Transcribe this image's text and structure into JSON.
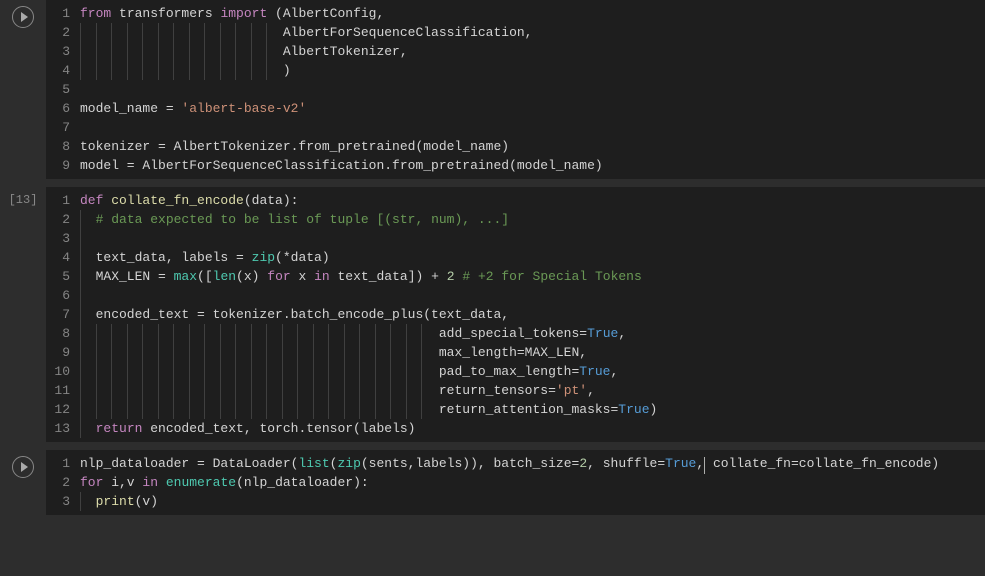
{
  "cells": [
    {
      "indicator": "play",
      "exec_label": "",
      "lines": [
        {
          "n": "1",
          "t": [
            [
              "kw",
              "from"
            ],
            [
              "op",
              " transformers "
            ],
            [
              "kw",
              "import"
            ],
            [
              "op",
              " (AlbertConfig,"
            ]
          ]
        },
        {
          "n": "2",
          "g": [
            0,
            1,
            2,
            3,
            4,
            5,
            6,
            7,
            8,
            9,
            10,
            11,
            12
          ],
          "t": [
            [
              "op",
              "                          AlbertForSequenceClassification,"
            ]
          ]
        },
        {
          "n": "3",
          "g": [
            0,
            1,
            2,
            3,
            4,
            5,
            6,
            7,
            8,
            9,
            10,
            11,
            12
          ],
          "t": [
            [
              "op",
              "                          AlbertTokenizer,"
            ]
          ]
        },
        {
          "n": "4",
          "g": [
            0,
            1,
            2,
            3,
            4,
            5,
            6,
            7,
            8,
            9,
            10,
            11,
            12
          ],
          "t": [
            [
              "op",
              "                          )"
            ]
          ]
        },
        {
          "n": "5",
          "t": []
        },
        {
          "n": "6",
          "t": [
            [
              "op",
              "model_name = "
            ],
            [
              "str",
              "'albert-base-v2'"
            ]
          ]
        },
        {
          "n": "7",
          "t": []
        },
        {
          "n": "8",
          "t": [
            [
              "op",
              "tokenizer = AlbertTokenizer.from_pretrained(model_name)"
            ]
          ]
        },
        {
          "n": "9",
          "t": [
            [
              "op",
              "model = AlbertForSequenceClassification.from_pretrained(model_name)"
            ]
          ]
        }
      ]
    },
    {
      "indicator": "label",
      "exec_label": "[13]",
      "lines": [
        {
          "n": "1",
          "t": [
            [
              "kw",
              "def"
            ],
            [
              "op",
              " "
            ],
            [
              "fn",
              "collate_fn_encode"
            ],
            [
              "op",
              "(data):"
            ]
          ]
        },
        {
          "n": "2",
          "g": [
            0
          ],
          "t": [
            [
              "op",
              "  "
            ],
            [
              "cmt",
              "# data expected to be list of tuple [(str, num), ...]"
            ]
          ]
        },
        {
          "n": "3",
          "g": [
            0
          ],
          "t": []
        },
        {
          "n": "4",
          "g": [
            0
          ],
          "t": [
            [
              "op",
              "  text_data, labels = "
            ],
            [
              "cls",
              "zip"
            ],
            [
              "op",
              "(*data)"
            ]
          ]
        },
        {
          "n": "5",
          "g": [
            0
          ],
          "t": [
            [
              "op",
              "  MAX_LEN = "
            ],
            [
              "cls",
              "max"
            ],
            [
              "op",
              "(["
            ],
            [
              "cls",
              "len"
            ],
            [
              "op",
              "(x) "
            ],
            [
              "kw",
              "for"
            ],
            [
              "op",
              " x "
            ],
            [
              "kw",
              "in"
            ],
            [
              "op",
              " text_data]) + "
            ],
            [
              "num",
              "2"
            ],
            [
              "op",
              " "
            ],
            [
              "cmt",
              "# +2 for Special Tokens"
            ]
          ]
        },
        {
          "n": "6",
          "g": [
            0
          ],
          "t": []
        },
        {
          "n": "7",
          "g": [
            0
          ],
          "t": [
            [
              "op",
              "  encoded_text = tokenizer.batch_encode_plus(text_data,"
            ]
          ]
        },
        {
          "n": "8",
          "g": [
            0,
            1,
            2,
            3,
            4,
            5,
            6,
            7,
            8,
            9,
            10,
            11,
            12,
            13,
            14,
            15,
            16,
            17,
            18,
            19,
            20,
            21,
            22
          ],
          "t": [
            [
              "op",
              "                                              add_special_tokens="
            ],
            [
              "bool",
              "True"
            ],
            [
              "op",
              ","
            ]
          ]
        },
        {
          "n": "9",
          "g": [
            0,
            1,
            2,
            3,
            4,
            5,
            6,
            7,
            8,
            9,
            10,
            11,
            12,
            13,
            14,
            15,
            16,
            17,
            18,
            19,
            20,
            21,
            22
          ],
          "t": [
            [
              "op",
              "                                              max_length=MAX_LEN,"
            ]
          ]
        },
        {
          "n": "10",
          "g": [
            0,
            1,
            2,
            3,
            4,
            5,
            6,
            7,
            8,
            9,
            10,
            11,
            12,
            13,
            14,
            15,
            16,
            17,
            18,
            19,
            20,
            21,
            22
          ],
          "t": [
            [
              "op",
              "                                              pad_to_max_length="
            ],
            [
              "bool",
              "True"
            ],
            [
              "op",
              ","
            ]
          ]
        },
        {
          "n": "11",
          "g": [
            0,
            1,
            2,
            3,
            4,
            5,
            6,
            7,
            8,
            9,
            10,
            11,
            12,
            13,
            14,
            15,
            16,
            17,
            18,
            19,
            20,
            21,
            22
          ],
          "t": [
            [
              "op",
              "                                              return_tensors="
            ],
            [
              "str",
              "'pt'"
            ],
            [
              "op",
              ","
            ]
          ]
        },
        {
          "n": "12",
          "g": [
            0,
            1,
            2,
            3,
            4,
            5,
            6,
            7,
            8,
            9,
            10,
            11,
            12,
            13,
            14,
            15,
            16,
            17,
            18,
            19,
            20,
            21,
            22
          ],
          "t": [
            [
              "op",
              "                                              return_attention_masks="
            ],
            [
              "bool",
              "True"
            ],
            [
              "op",
              ")"
            ]
          ]
        },
        {
          "n": "13",
          "g": [
            0
          ],
          "t": [
            [
              "op",
              "  "
            ],
            [
              "kw",
              "return"
            ],
            [
              "op",
              " encoded_text, torch.tensor(labels)"
            ]
          ]
        }
      ]
    },
    {
      "indicator": "play",
      "exec_label": "",
      "lines": [
        {
          "n": "1",
          "t": [
            [
              "op",
              "nlp_dataloader = DataLoader("
            ],
            [
              "cls",
              "list"
            ],
            [
              "op",
              "("
            ],
            [
              "cls",
              "zip"
            ],
            [
              "op",
              "(sents,labels)), batch_size="
            ],
            [
              "num",
              "2"
            ],
            [
              "op",
              ", shuffle="
            ],
            [
              "bool",
              "True"
            ],
            [
              "op",
              ","
            ],
            [
              "cursor",
              ""
            ],
            [
              "op",
              " collate_fn=collate_fn_encode)"
            ]
          ]
        },
        {
          "n": "2",
          "t": [
            [
              "kw",
              "for"
            ],
            [
              "op",
              " i,v "
            ],
            [
              "kw",
              "in"
            ],
            [
              "op",
              " "
            ],
            [
              "cls",
              "enumerate"
            ],
            [
              "op",
              "(nlp_dataloader):"
            ]
          ]
        },
        {
          "n": "3",
          "g": [
            0
          ],
          "t": [
            [
              "op",
              "  "
            ],
            [
              "fn",
              "print"
            ],
            [
              "op",
              "(v)"
            ]
          ]
        }
      ]
    }
  ]
}
